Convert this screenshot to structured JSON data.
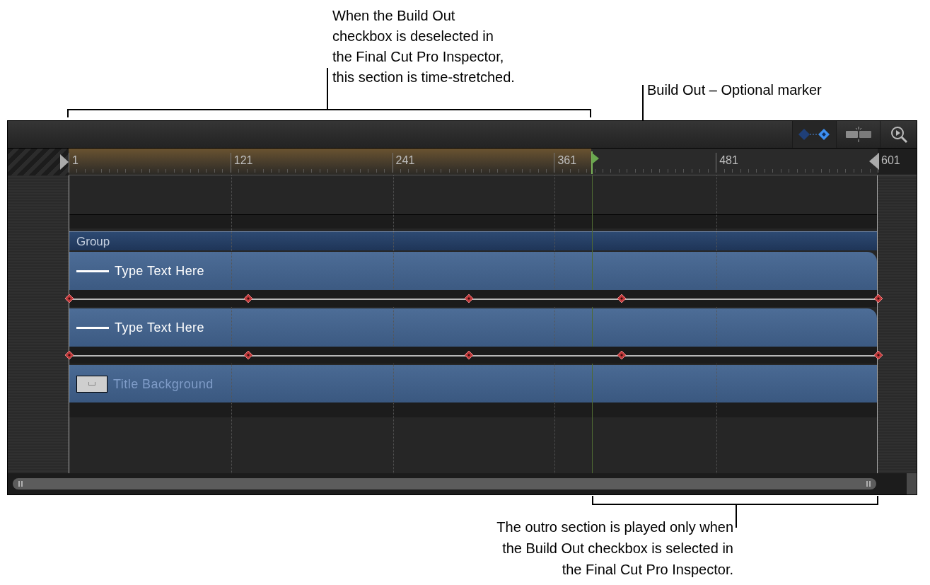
{
  "callouts": [
    {
      "kind": "top",
      "text": "When the Build Out\ncheckbox is deselected in\nthe Final Cut Pro Inspector,\nthis section is time-stretched."
    },
    {
      "kind": "marker",
      "text": "Build Out – Optional marker"
    },
    {
      "kind": "bottom",
      "text": "The outro section is played only when\nthe Build Out checkbox is selected in\nthe Final Cut Pro Inspector."
    }
  ],
  "ruler": {
    "labels": [
      "1",
      "121",
      "241",
      "361",
      "481",
      "601"
    ]
  },
  "layers": [
    {
      "kind": "group",
      "name": "Group"
    },
    {
      "kind": "text",
      "name": "Type Text Here"
    },
    {
      "kind": "keyframes"
    },
    {
      "kind": "text",
      "name": "Type Text Here"
    },
    {
      "kind": "keyframes"
    },
    {
      "kind": "image",
      "name": "Title Background"
    }
  ]
}
